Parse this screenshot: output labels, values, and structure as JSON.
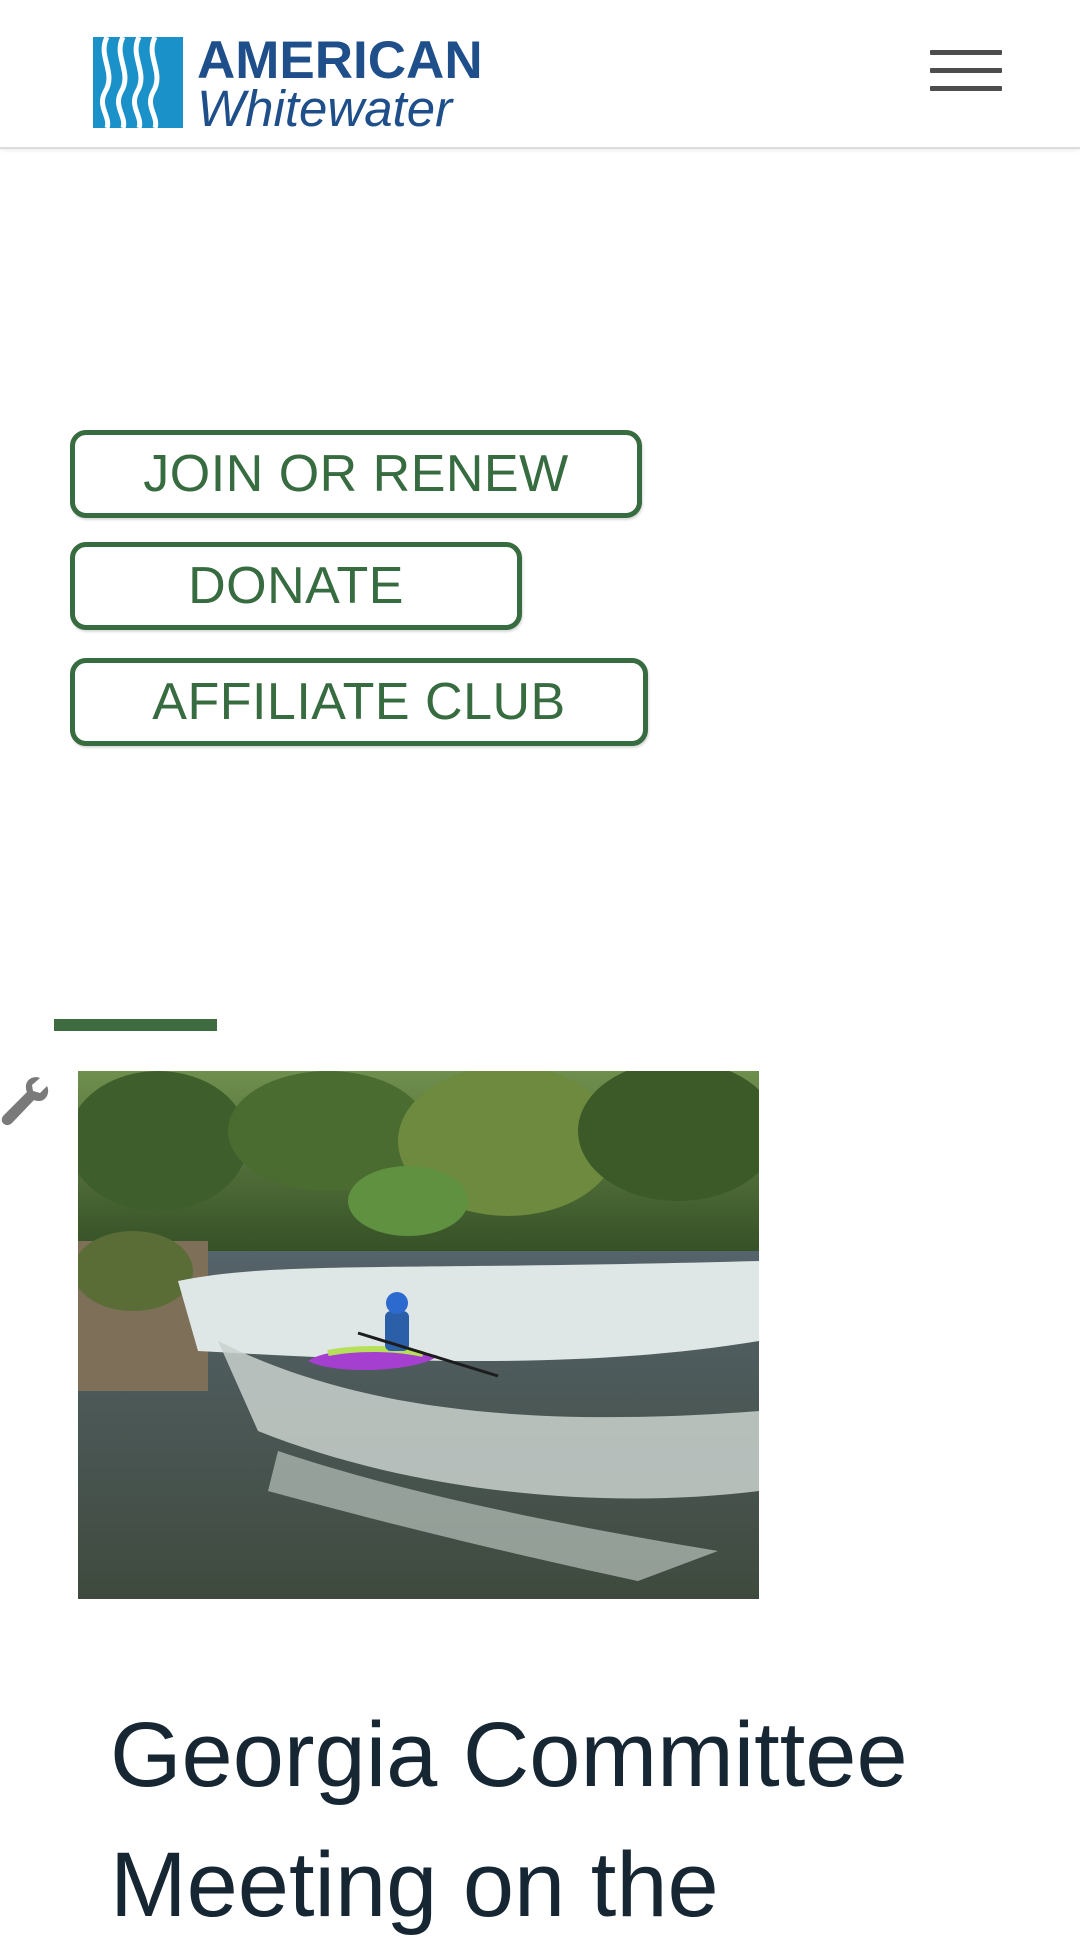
{
  "header": {
    "logo": {
      "line1": "AMERICAN",
      "line2": "Whitewater",
      "brand_colors": [
        "#1a92c9",
        "#1f4f8a"
      ]
    },
    "menu_icon": "hamburger-menu-icon"
  },
  "actions": {
    "join_label": "JOIN OR RENEW",
    "donate_label": "DONATE",
    "affiliate_label": "AFFILIATE CLUB",
    "accent_color": "#376b40"
  },
  "article": {
    "edit_icon": "wrench-icon",
    "image_subject": "kayaker-on-river-rapids",
    "title": "Georgia Committee Meeting on the"
  }
}
